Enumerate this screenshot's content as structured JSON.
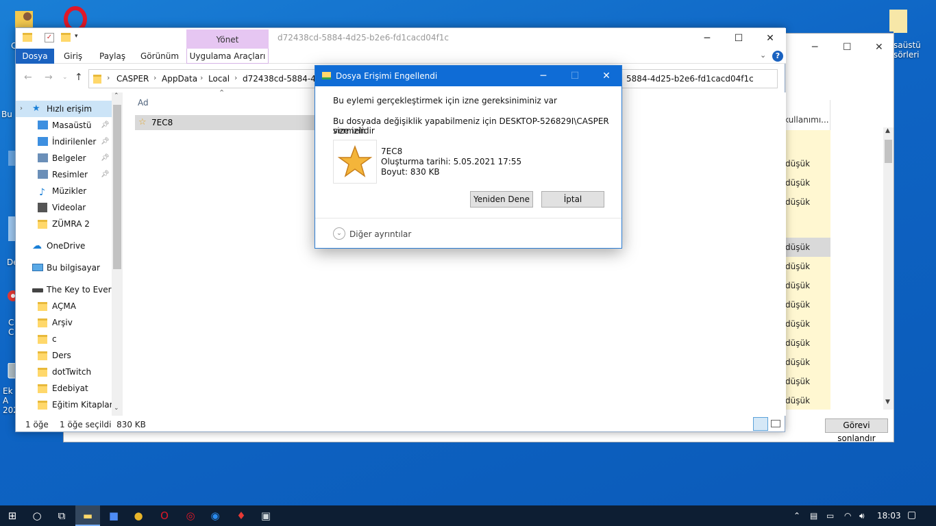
{
  "desktop": {
    "icons": [
      {
        "name": "user-folder-icon",
        "label": "C"
      },
      {
        "name": "opera-icon",
        "label": ""
      },
      {
        "name": "recycle-icon",
        "label": "Bu"
      },
      {
        "name": "doc-icon",
        "label": "De"
      },
      {
        "name": "chrome-icon",
        "label": "C C"
      },
      {
        "name": "phone-icon",
        "label": "Ek A 202"
      }
    ],
    "right_icon_label_1": "saüstü",
    "right_icon_label_2": "sörleri"
  },
  "background_window": {
    "column_header": "kullanımı...",
    "rows": [
      "düşük",
      "düşük",
      "düşük",
      "düşük",
      "düşük",
      "düşük",
      "düşük",
      "düşük",
      "düşük",
      "düşük",
      "düşük",
      "düşük",
      "düşük"
    ],
    "end_task_label": "Görevi sonlandır"
  },
  "explorer": {
    "window_title": "d72438cd-5884-4d25-b2e6-fd1cacd04f1c",
    "manage_label": "Yönet",
    "ribbon_tabs": [
      "Dosya",
      "Giriş",
      "Paylaş",
      "Görünüm",
      "Uygulama Araçları"
    ],
    "help": "?",
    "breadcrumbs": [
      "CASPER",
      "AppData",
      "Local",
      "d72438cd-5884-4d25",
      "5884-4d25-b2e6-fd1cacd04f1c"
    ],
    "nav": {
      "quick_access": "Hızlı erişim",
      "pinned": [
        "Masaüstü",
        "İndirilenler",
        "Belgeler",
        "Resimler"
      ],
      "recent": [
        "Müzikler",
        "Videolar",
        "ZÜMRA 2"
      ],
      "onedrive": "OneDrive",
      "this_pc": "Bu bilgisayar",
      "drive": "The Key to Everyth",
      "folders": [
        "AÇMA",
        "Arşiv",
        "c",
        "Ders",
        "dotTwitch",
        "Edebiyat",
        "Eğitim Kitapları"
      ]
    },
    "column_name": "Ad",
    "file_name": "7EC8",
    "status": {
      "count": "1 öğe",
      "selected": "1 öğe seçildi  830 KB"
    }
  },
  "dialog": {
    "title": "Dosya Erişimi Engellendi",
    "line1": "Bu eylemi gerçekleştirmek için izne gereksiniminiz var",
    "line2": "Bu dosyada değişiklik yapabilmeniz için DESKTOP-526829I\\CASPER size izin",
    "line3": "vermelidir",
    "file_name": "7EC8",
    "created": "Oluşturma tarihi: 5.05.2021 17:55",
    "size": "Boyut: 830 KB",
    "retry": "Yeniden Dene",
    "cancel": "İptal",
    "more_details": "Diğer ayrıntılar"
  },
  "taskbar": {
    "clock": "18:03"
  },
  "colors": {
    "accent": "#0f6cd6",
    "manage_tab": "#e6c6f2",
    "taskbar": "#0d1e33",
    "low_usage": "#fff7d1"
  }
}
